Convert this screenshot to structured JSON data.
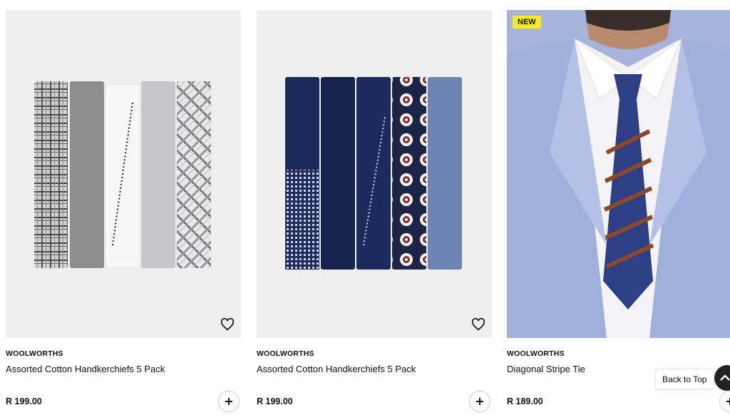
{
  "products": [
    {
      "brand": "WOOLWORTHS",
      "name": "Assorted Cotton Handkerchiefs 5 Pack",
      "price": "R 199.00",
      "badge": ""
    },
    {
      "brand": "WOOLWORTHS",
      "name": "Assorted Cotton Handkerchiefs 5 Pack",
      "price": "R 199.00",
      "badge": ""
    },
    {
      "brand": "WOOLWORTHS",
      "name": "Diagonal Stripe Tie",
      "price": "R 189.00",
      "badge": "NEW"
    }
  ],
  "back_to_top": "Back to Top",
  "colors": {
    "badge": "#f7ec1c",
    "image_bg": "#efefef",
    "text": "#111111"
  },
  "icons": {
    "wishlist": "heart-icon",
    "add": "plus-icon",
    "back_to_top": "chevron-up-icon"
  }
}
